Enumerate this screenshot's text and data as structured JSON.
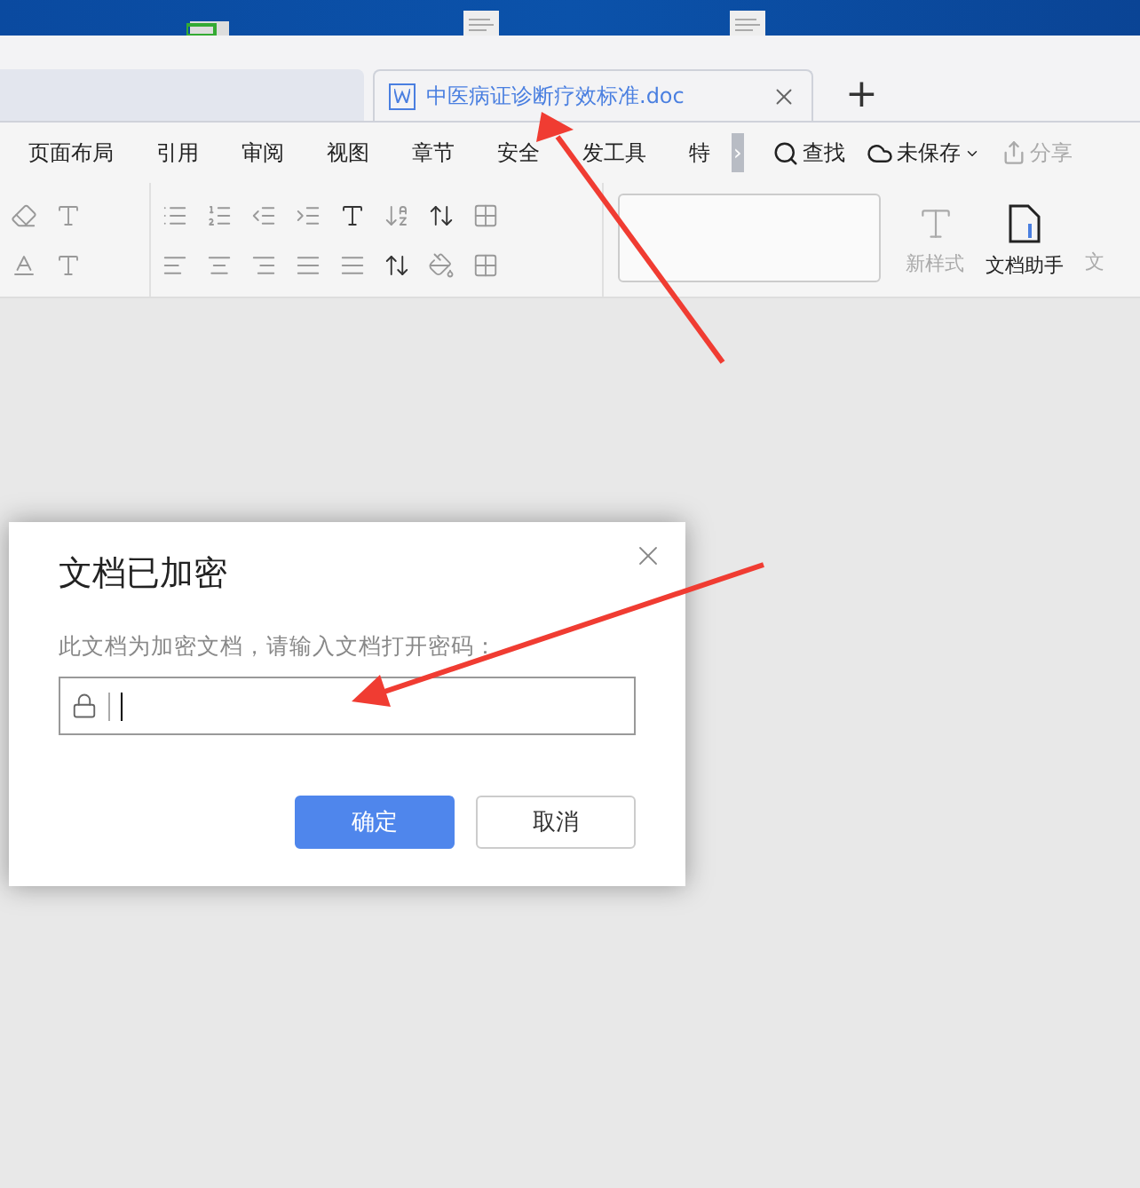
{
  "desktop": {
    "icons": [
      {
        "kind": "app"
      },
      {
        "kind": "document"
      },
      {
        "kind": "document"
      }
    ]
  },
  "tabs": [
    {
      "label": "中医病证诊断疗效标准.doc",
      "selected": true
    }
  ],
  "new_tab": "+",
  "menu": {
    "items": [
      {
        "label": "页面布局"
      },
      {
        "label": "引用"
      },
      {
        "label": "审阅"
      },
      {
        "label": "视图"
      },
      {
        "label": "章节"
      },
      {
        "label": "安全"
      },
      {
        "label": "发工具"
      },
      {
        "label": "特"
      }
    ],
    "more": "›",
    "search": "查找",
    "save_status": "未保存",
    "share": "分享"
  },
  "toolbar": {
    "new_style": "新样式",
    "assistant": "文档助手",
    "cut_label": "文"
  },
  "dialog": {
    "title": "文档已加密",
    "message": "此文档为加密文档，请输入文档打开密码：",
    "ok": "确定",
    "cancel": "取消"
  }
}
